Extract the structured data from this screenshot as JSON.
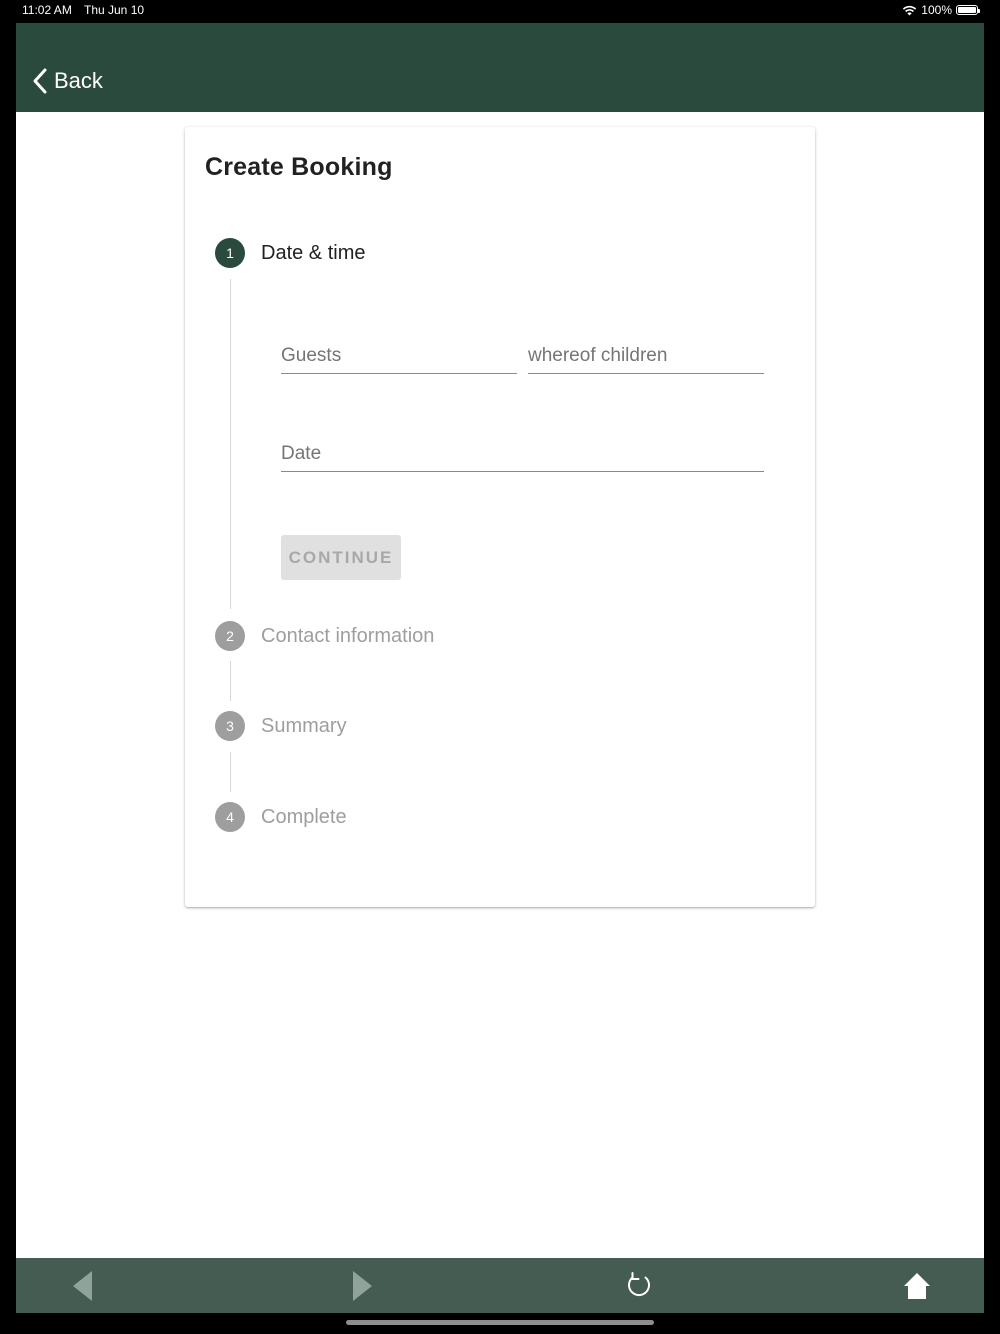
{
  "status_bar": {
    "time": "11:02 AM",
    "date": "Thu Jun 10",
    "battery": "100%",
    "battery_level": 1.0
  },
  "header": {
    "back_label": "Back"
  },
  "booking": {
    "title": "Create Booking",
    "steps": [
      {
        "number": "1",
        "label": "Date & time",
        "state": "active"
      },
      {
        "number": "2",
        "label": "Contact information",
        "state": "inactive"
      },
      {
        "number": "3",
        "label": "Summary",
        "state": "inactive"
      },
      {
        "number": "4",
        "label": "Complete",
        "state": "inactive"
      }
    ],
    "form": {
      "guests_placeholder": "Guests",
      "children_placeholder": "whereof children",
      "date_placeholder": "Date",
      "continue_label": "CONTINUE"
    }
  },
  "colors": {
    "primary": "#2b4a3e",
    "bottom_bar": "#445c52",
    "inactive": "#9e9e9e"
  },
  "bottom_nav": {
    "icons": [
      "back-arrow-icon",
      "forward-arrow-icon",
      "refresh-icon",
      "home-icon"
    ]
  }
}
